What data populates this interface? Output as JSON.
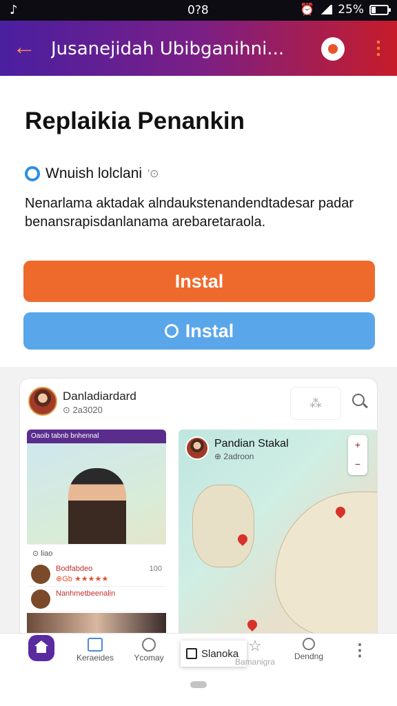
{
  "status_bar": {
    "time": "0?8",
    "battery": "25%",
    "battery_level": 0.25
  },
  "app_bar": {
    "back_icon": "back-arrow-icon",
    "title": "Jusanejidah  Ubibganihni...",
    "settings_icon": "gear-icon",
    "more_icon": "more-vertical-icon"
  },
  "header": {
    "title": "Replaikia Penankin",
    "meta_label": "Wnuish lolclani",
    "meta_suffix": "'⊙"
  },
  "description": "Nenarlama aktadak alndaukstenandendtadesar padar benansrapisdanlanama arebaretaraola.",
  "buttons": {
    "primary_label": "Instal",
    "secondary_label": "Instal"
  },
  "card": {
    "name": "Danladiardard",
    "sub": "⊙ 2a3020",
    "mini": {
      "top_label": "Oaoib tabnb bnhennal",
      "strip_label": "⊙ liao",
      "rows": [
        {
          "label": "Bodfabdeo",
          "stars": "⊕Gb ★★★★★",
          "value": "100"
        },
        {
          "label": "Nanhmetbeenalin",
          "stars": "",
          "value": ""
        }
      ]
    },
    "map": {
      "name": "Pandian Stakal",
      "sub": "⊕ 2adroon"
    }
  },
  "bottom_nav": {
    "items": [
      {
        "label": ""
      },
      {
        "label": "Keraeides"
      },
      {
        "label": "Ycomay"
      },
      {
        "label": "Slanoka"
      },
      {
        "label": "Bamanigra"
      },
      {
        "label": "Dendng"
      }
    ]
  }
}
